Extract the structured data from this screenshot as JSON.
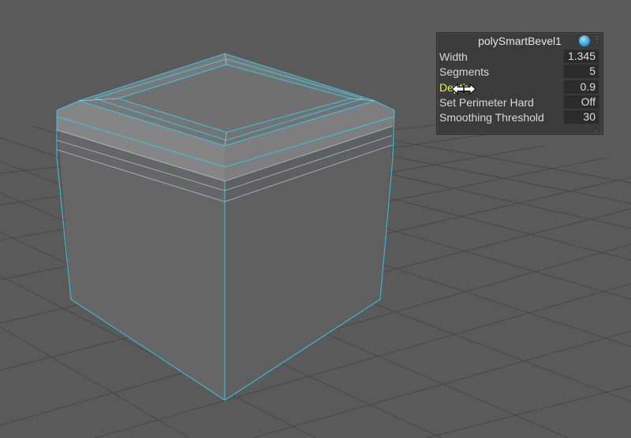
{
  "hud": {
    "title": "polySmartBevel1",
    "icon": "node-sphere-icon",
    "rows": [
      {
        "label": "Width",
        "value": "1.345",
        "highlight": false
      },
      {
        "label": "Segments",
        "value": "5",
        "highlight": false
      },
      {
        "label": "Depth",
        "value": "0.9",
        "highlight": true
      },
      {
        "label": "Set Perimeter Hard",
        "value": "Off",
        "highlight": false
      },
      {
        "label": "Smoothing Threshold",
        "value": "30",
        "highlight": false
      }
    ]
  },
  "colors": {
    "background": "#5a5a5a",
    "grid": "#474747",
    "wireframe": "#38c6e6",
    "highlight_label": "#f0f03a"
  }
}
